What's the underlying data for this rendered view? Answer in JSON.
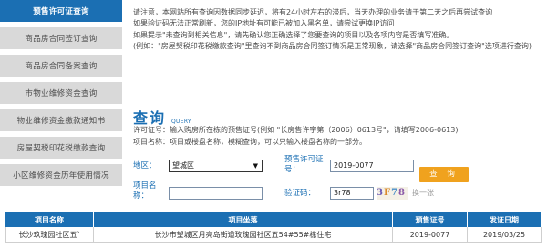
{
  "sidebar": {
    "items": [
      {
        "label": "预售许可证查询",
        "active": true
      },
      {
        "label": "商品房合同签订查询",
        "active": false
      },
      {
        "label": "商品房合同备案查询",
        "active": false
      },
      {
        "label": "市物业维修资金查询",
        "active": false
      },
      {
        "label": "物业维修资金缴款通知书",
        "active": false
      },
      {
        "label": "房屋契税印花税缴款查询",
        "active": false
      },
      {
        "label": "小区维修资金历年使用情况",
        "active": false
      }
    ]
  },
  "notice": {
    "line1": "请注意，本网站所有查询因数据同步延迟，将有24小时左右的滞后，当天办理的业务请于第二天之后再尝试查询",
    "line2": "如果验证码无法正常刷新，您的IP地址有可能已被加入黑名单，请尝试更换IP访问",
    "line3": "如果提示\"未查询到相关信息\"，请先确认您正确选择了您要查询的项目以及各项内容是否填写准确。",
    "line4": "(例如：\"房屋契税印花税缴款查询\"里查询不到商品房合同签订情况是正常现象，请选择\"商品房合同签订查询\"选项进行查询)"
  },
  "query": {
    "title": "查询",
    "subtitle": "QUERY",
    "hint1": "许可证号：输入购房所在栋的预售证号(例如 \"长房售许字第（2006）0613号\"，请填写2006-0613)",
    "hint2": "项目名称：项目或楼盘名称，模糊查询，可以只输入楼盘名称的一部分。"
  },
  "form": {
    "district_label": "地区：",
    "district_value": "望城区",
    "permit_label": "预售许可证号：",
    "permit_value": "2019-0077",
    "project_label": "项目名称：",
    "project_value": "",
    "captcha_label": "验证码：",
    "captcha_value": "3r78",
    "captcha_image_text": [
      "3",
      "F",
      "7",
      "8"
    ],
    "refresh_label": "换一张",
    "search_label": "查 询"
  },
  "table": {
    "headers": [
      "项目名称",
      "项目坐落",
      "预售证号",
      "发证日期"
    ],
    "rows": [
      [
        "长沙玖瑰园社区五`",
        "长沙市望城区月亮岛街道玫瑰园社区五54#55#栋住宅",
        "2019-0077",
        "2019/03/25"
      ]
    ]
  },
  "colors": {
    "accent": "#1b6fb3",
    "sidebar_inactive": "#d9d9d9",
    "button": "#f0a21e"
  }
}
